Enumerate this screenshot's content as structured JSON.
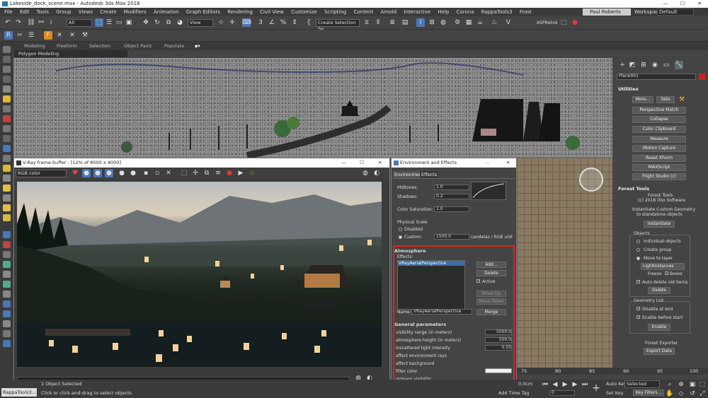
{
  "app": {
    "title": "Lakeside_dock_scene.max - Autodesk 3ds Max 2018",
    "user": "Paul Roberts",
    "workspaces_label": "Workspaces:",
    "workspace_value": "Default"
  },
  "menu": [
    "File",
    "Edit",
    "Tools",
    "Group",
    "Views",
    "Create",
    "Modifiers",
    "Animation",
    "Graph Editors",
    "Rendering",
    "Civil View",
    "Customize",
    "Scripting",
    "Content",
    "Arnold",
    "Interactive",
    "Help",
    "Corona",
    "RappaTools3",
    "Frost"
  ],
  "toolbar": {
    "selection_filter": "All",
    "coord_system": "View",
    "selection_set": "Create Selection Se",
    "asp_relink": "ASPRelink"
  },
  "ribbon": {
    "tabs": [
      "Modeling",
      "Freeform",
      "Selection",
      "Object Paint",
      "Populate"
    ],
    "sub_label": "Polygon Modeling"
  },
  "command_panel": {
    "object_name": "Plane001",
    "utilities_title": "Utilities",
    "more": "More...",
    "sets": "Sets",
    "utility_buttons": [
      "Perspective Match",
      "Collapse",
      "Color Clipboard",
      "Measure",
      "Motion Capture",
      "Reset XForm",
      "MAXScript",
      "Flight Studio (c)"
    ],
    "forest_tools_title": "Forest Tools",
    "forest_tools_name": "Forest Tools",
    "forest_copyright": "(c) 2018 iToo Software",
    "forest_desc1": "Instantiate Custom Geometry",
    "forest_desc2": "to standalone objects",
    "instantiate": "Instantiate",
    "objects_group": "Objects",
    "opt_individual": "Individual objects",
    "opt_group": "Create group",
    "opt_layer": "Move to layer",
    "layer_value": "LightInstances",
    "freeze": "Freeze",
    "boxes": "Boxes",
    "auto_delete": "Auto delete old items",
    "delete": "Delete",
    "geometry_list": "Geometry List",
    "disable_end": "Disable at end",
    "enable_before": "Enable before start",
    "enable": "Enable",
    "forest_exporter": "Forest Exporter",
    "export_data": "Export Data"
  },
  "vfb": {
    "title": "V-Ray frame buffer - [12% of 8000 x 4000]",
    "channel": "RGB color"
  },
  "env": {
    "title": "Environment and Effects",
    "tab_environment": "Environment",
    "tab_effects": "Effects",
    "midtones_label": "Midtones:",
    "midtones": "1.0",
    "shadows_label": "Shadows:",
    "shadows": "0.2",
    "color_sat_label": "Color Saturation:",
    "color_sat": "1.0",
    "physical_scale": "Physical Scale",
    "disabled": "Disabled",
    "custom": "Custom:",
    "custom_value": "1500.0",
    "custom_unit": "candelas / RGB unit",
    "atmosphere_title": "Atmosphere",
    "effects_label": "Effects:",
    "effect_item": "VRayAerialPerspective",
    "add": "Add...",
    "delete": "Delete",
    "active": "Active",
    "move_up": "Move Up",
    "move_down": "Move Down",
    "name_label": "Name:",
    "name_value": "VRayAerialPerspective",
    "merge": "Merge",
    "general_params": "General parameters",
    "params": [
      {
        "label": "visibility range (in meters)",
        "value": "5000.0"
      },
      {
        "label": "atmosphere height (in meters)",
        "value": "500.0"
      },
      {
        "label": "inscattered light intensity",
        "value": "0.55"
      },
      {
        "label": "affect environment rays",
        "value": ""
      },
      {
        "label": "affect background",
        "value": ""
      },
      {
        "label": "filter color",
        "value": ""
      },
      {
        "label": "primary visibility",
        "value": ""
      }
    ]
  },
  "timeline": {
    "ticks": [
      "75",
      "80",
      "85",
      "90",
      "95",
      "100"
    ],
    "frame_counter": "0.0cm"
  },
  "status": {
    "script_label": "RappaTools3...",
    "selected": "1 Object Selected",
    "hint": "Click or click-and-drag to select objects",
    "add_time_tag": "Add Time Tag",
    "auto_key": "Auto Key",
    "set_key": "Set Key",
    "key_mode": "Selected",
    "key_filters": "Key Filters...",
    "frame": "0"
  }
}
